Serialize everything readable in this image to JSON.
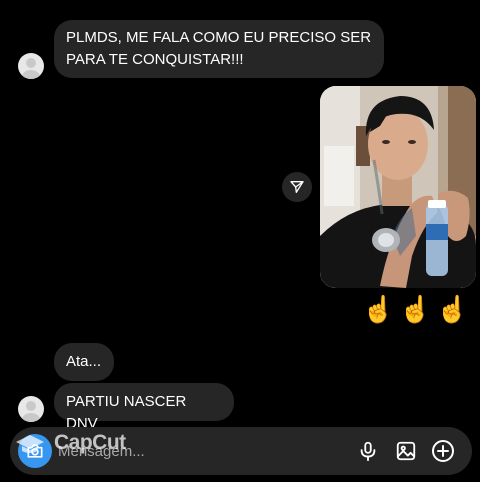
{
  "messages": [
    {
      "text": "PLMDS, ME FALA COMO EU PRECISO SER PARA TE CONQUISTAR!!!"
    },
    {
      "text": "Ata..."
    },
    {
      "text": "PARTIU NASCER DNV"
    }
  ],
  "reactions": [
    "☝️",
    "☝️",
    "☝️"
  ],
  "composer": {
    "placeholder": "Mensagem..."
  },
  "watermark": {
    "text": "CapCut"
  },
  "icons": {
    "share": "send-icon",
    "camera": "camera-icon",
    "mic": "microphone-icon",
    "gallery": "gallery-icon",
    "add": "plus-circle-icon"
  },
  "colors": {
    "background": "#000000",
    "bubble": "#262626",
    "camera_button": "#3797f0"
  }
}
